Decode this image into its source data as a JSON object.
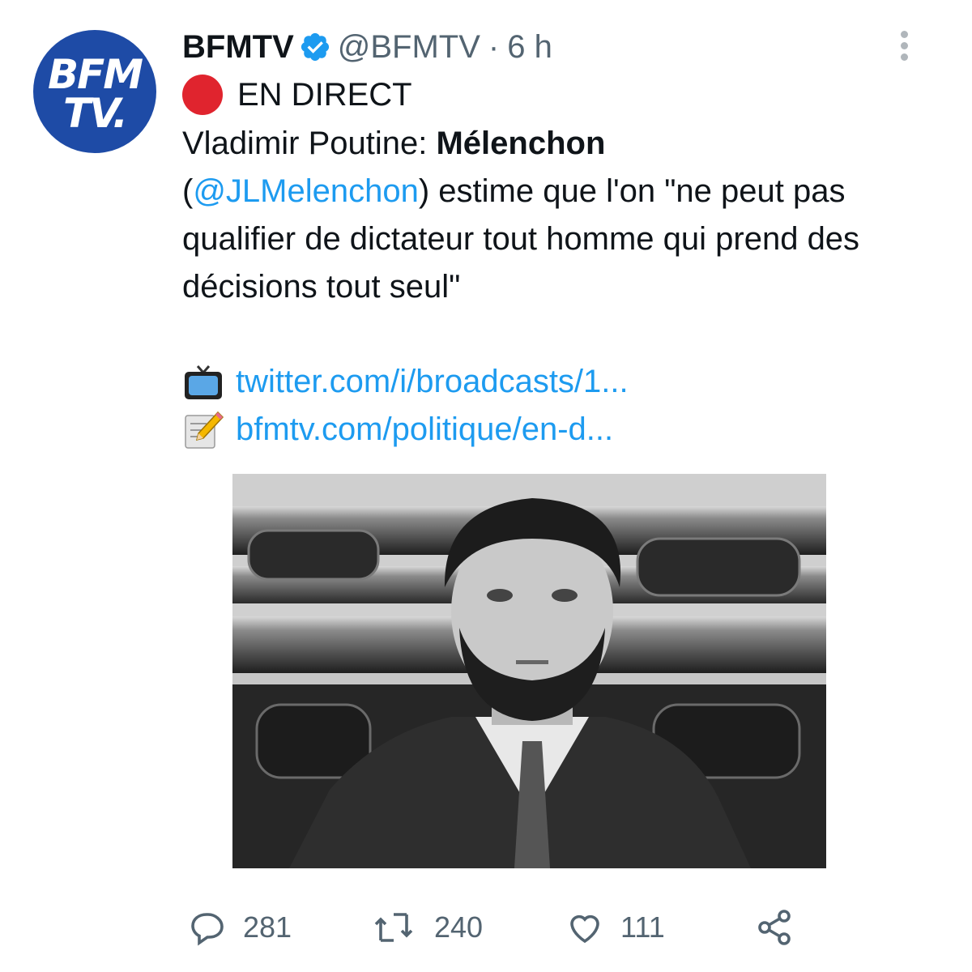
{
  "author": {
    "display_name": "BFMTV",
    "handle": "@BFMTV",
    "separator": "·",
    "time": "6 h",
    "verified": true,
    "avatar_logo_line1": "BFM",
    "avatar_logo_line2": "TV."
  },
  "live_badge": {
    "icon": "red-circle-icon",
    "label": "EN DIRECT"
  },
  "tweet_body": {
    "prefix": "Vladimir Poutine: ",
    "bold": "Mélenchon",
    "paren_open": "(",
    "mention": "@JLMelenchon",
    "rest": ") estime que l'on \"ne peut pas qualifier de dictateur tout homme qui prend des décisions tout seul\""
  },
  "links": [
    {
      "icon": "television-icon",
      "text": "twitter.com/i/broadcasts/1..."
    },
    {
      "icon": "memo-icon",
      "text": "bfmtv.com/politique/en-d..."
    }
  ],
  "media": {
    "description_icon": "photo-image"
  },
  "actions": {
    "replies": "281",
    "retweets": "240",
    "likes": "111"
  },
  "colors": {
    "link": "#1d9bf0",
    "text": "#0f1419",
    "secondary": "#536471",
    "live": "#e0242e",
    "brand": "#1e4ba6"
  }
}
